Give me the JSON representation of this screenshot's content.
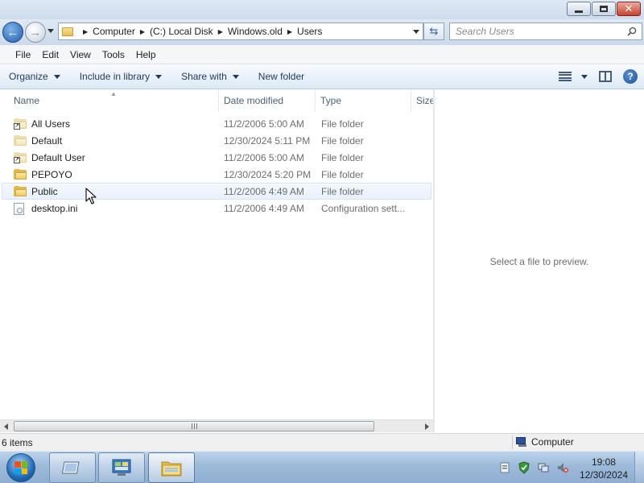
{
  "address_bar": {
    "breadcrumbs": [
      "Computer",
      "(C:) Local Disk",
      "Windows.old",
      "Users"
    ]
  },
  "search": {
    "placeholder": "Search Users"
  },
  "menu": [
    "File",
    "Edit",
    "View",
    "Tools",
    "Help"
  ],
  "commands": {
    "organize": "Organize",
    "include_in_library": "Include in library",
    "share_with": "Share with",
    "new_folder": "New folder"
  },
  "columns": {
    "name": "Name",
    "date_modified": "Date modified",
    "type": "Type",
    "size": "Size"
  },
  "files": [
    {
      "name": "All Users",
      "date": "11/2/2006 5:00 AM",
      "type": "File folder",
      "icon": "folder-shortcut-icon"
    },
    {
      "name": "Default",
      "date": "12/30/2024 5:11 PM",
      "type": "File folder",
      "icon": "folder-icon"
    },
    {
      "name": "Default User",
      "date": "11/2/2006 5:00 AM",
      "type": "File folder",
      "icon": "folder-shortcut-icon"
    },
    {
      "name": "PEPOYO",
      "date": "12/30/2024 5:20 PM",
      "type": "File folder",
      "icon": "folder-icon"
    },
    {
      "name": "Public",
      "date": "11/2/2006 4:49 AM",
      "type": "File folder",
      "icon": "folder-icon"
    },
    {
      "name": "desktop.ini",
      "date": "11/2/2006 4:49 AM",
      "type": "Configuration sett...",
      "icon": "config-file-icon"
    }
  ],
  "preview": {
    "message": "Select a file to preview."
  },
  "status": {
    "item_count": "6 items",
    "location": "Computer"
  },
  "taskbar": {
    "time": "19:08",
    "date": "12/30/2024"
  },
  "colors": {
    "accent": "#1f5fae",
    "command_text": "#1e395b",
    "taskbar": "#9dbad9"
  }
}
